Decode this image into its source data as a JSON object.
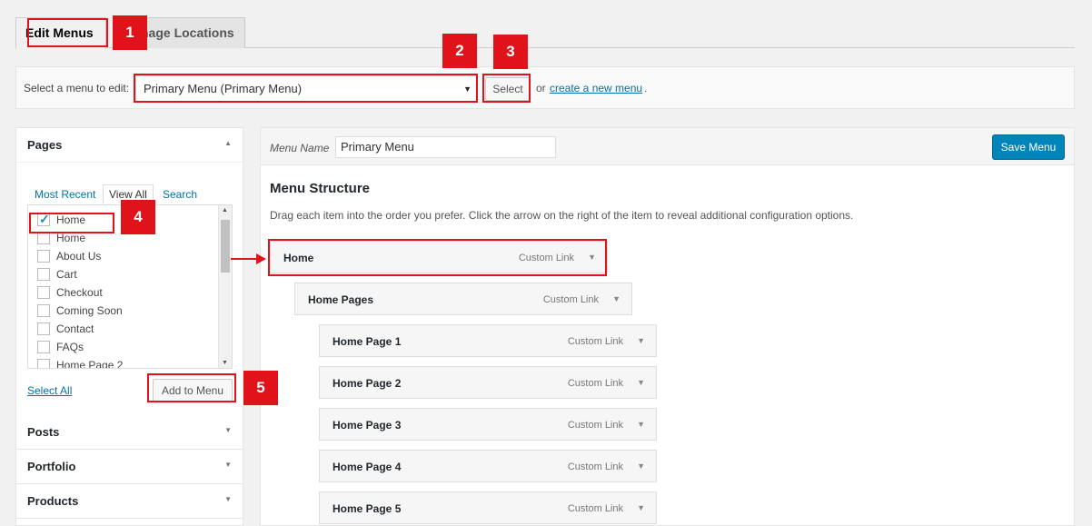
{
  "tabs": [
    {
      "label": "Edit Menus",
      "active": true
    },
    {
      "label": "Manage Locations",
      "visible_label": "nage Locations",
      "active": false
    }
  ],
  "select_bar": {
    "label": "Select a menu to edit:",
    "selected_menu": "Primary Menu (Primary Menu)",
    "select_button": "Select",
    "or_text": "or",
    "create_link": "create a new menu",
    "period": "."
  },
  "pages_panel": {
    "title": "Pages",
    "subtabs": [
      "Most Recent",
      "View All",
      "Search"
    ],
    "items": [
      {
        "label": "Home",
        "checked": true
      },
      {
        "label": "Home",
        "checked": false
      },
      {
        "label": "About Us",
        "checked": false
      },
      {
        "label": "Cart",
        "checked": false
      },
      {
        "label": "Checkout",
        "checked": false
      },
      {
        "label": "Coming Soon",
        "checked": false
      },
      {
        "label": "Contact",
        "checked": false
      },
      {
        "label": "FAQs",
        "checked": false
      },
      {
        "label": "Home Page 2",
        "checked": false
      }
    ],
    "select_all": "Select All",
    "add_button": "Add to Menu"
  },
  "other_panels": [
    "Posts",
    "Portfolio",
    "Products"
  ],
  "menu_editor": {
    "name_label": "Menu Name",
    "name_value": "Primary Menu",
    "save_button": "Save Menu",
    "structure_title": "Menu Structure",
    "structure_desc": "Drag each item into the order you prefer. Click the arrow on the right of the item to reveal additional configuration options.",
    "items": [
      {
        "label": "Home",
        "type": "Custom Link",
        "depth": 0
      },
      {
        "label": "Home Pages",
        "type": "Custom Link",
        "depth": 1
      },
      {
        "label": "Home Page 1",
        "type": "Custom Link",
        "depth": 2
      },
      {
        "label": "Home Page 2",
        "type": "Custom Link",
        "depth": 2
      },
      {
        "label": "Home Page 3",
        "type": "Custom Link",
        "depth": 2
      },
      {
        "label": "Home Page 4",
        "type": "Custom Link",
        "depth": 2
      },
      {
        "label": "Home Page 5",
        "type": "Custom Link",
        "depth": 2
      }
    ]
  },
  "annotations": [
    "1",
    "2",
    "3",
    "4",
    "5"
  ],
  "colors": {
    "highlight": "#e0121a",
    "primary_button": "#0085ba",
    "link": "#0073aa"
  }
}
